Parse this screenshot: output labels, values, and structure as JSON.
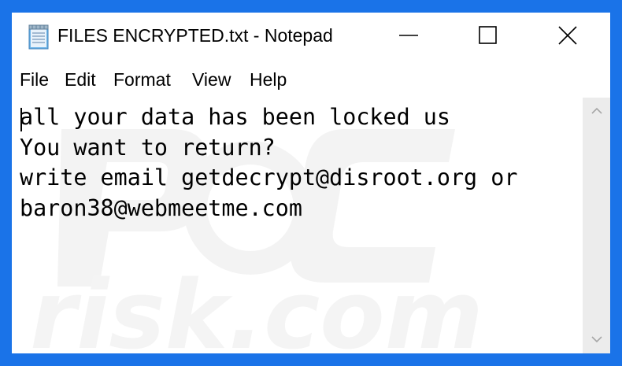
{
  "window": {
    "title": "FILES ENCRYPTED.txt - Notepad"
  },
  "menu": {
    "file": "File",
    "edit": "Edit",
    "format": "Format",
    "view": "View",
    "help": "Help"
  },
  "document": {
    "lines": [
      "all your data has been locked us",
      "You want to return?",
      "write email getdecrypt@disroot.org or",
      "baron38@webmeetme.com"
    ]
  },
  "watermark": {
    "logo_text": "PC",
    "site_text": "risk.com"
  },
  "colors": {
    "frame": "#1a73e8",
    "scrollbar": "#ececec",
    "watermark": "#f2f2f2"
  }
}
